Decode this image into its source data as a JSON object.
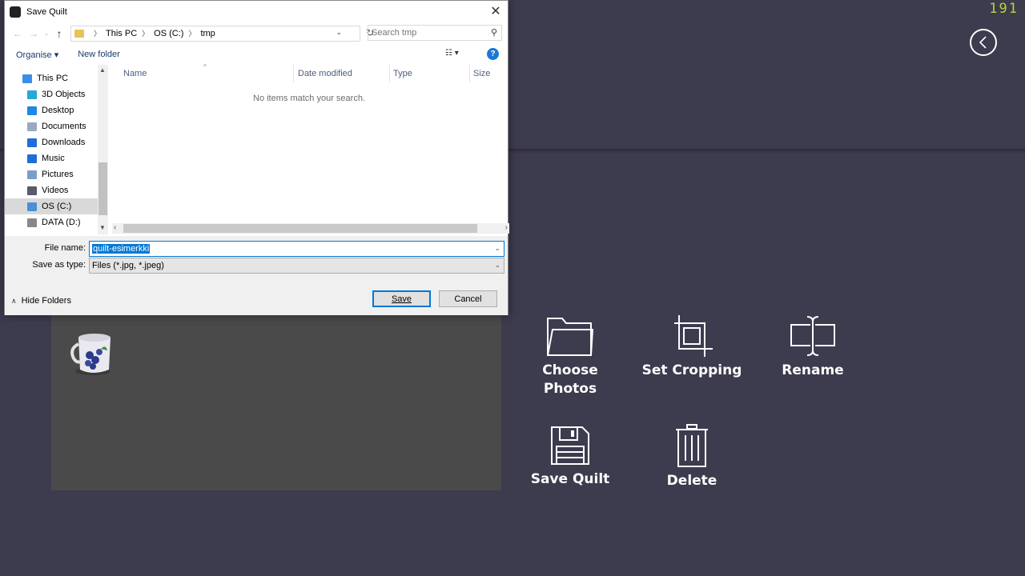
{
  "app": {
    "counter": "191",
    "actions": {
      "choose_photos": "Choose\nPhotos",
      "set_cropping": "Set Cropping",
      "rename": "Rename",
      "save_quilt": "Save Quilt",
      "delete": "Delete"
    }
  },
  "dialog": {
    "title": "Save Quilt",
    "breadcrumb": [
      "This PC",
      "OS (C:)",
      "tmp"
    ],
    "search_placeholder": "Search tmp",
    "toolbar": {
      "organise": "Organise",
      "new_folder": "New folder"
    },
    "nav_items": [
      {
        "label": "This PC",
        "color": "#3a8ee6"
      },
      {
        "label": "3D Objects",
        "color": "#2aa7d9"
      },
      {
        "label": "Desktop",
        "color": "#1e88e5"
      },
      {
        "label": "Documents",
        "color": "#9aa9bd"
      },
      {
        "label": "Downloads",
        "color": "#1e6fd9"
      },
      {
        "label": "Music",
        "color": "#1e6fd9"
      },
      {
        "label": "Pictures",
        "color": "#7a9ec9"
      },
      {
        "label": "Videos",
        "color": "#5a5a6a"
      },
      {
        "label": "OS (C:)",
        "color": "#4a90d9"
      },
      {
        "label": "DATA (D:)",
        "color": "#888888"
      }
    ],
    "selected_nav": "OS (C:)",
    "columns": [
      "Name",
      "Date modified",
      "Type",
      "Size"
    ],
    "empty_message": "No items match your search.",
    "file_name_label": "File name:",
    "file_name_value": "quilt-esimerkki",
    "save_as_type_label": "Save as type:",
    "save_as_type_value": "Files (*.jpg, *.jpeg)",
    "hide_folders": "Hide Folders",
    "save_button": "Save",
    "cancel_button": "Cancel"
  }
}
